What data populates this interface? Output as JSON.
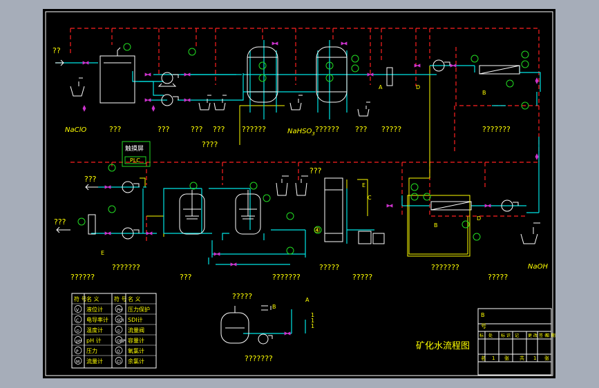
{
  "page": {
    "background": "#a6adb9",
    "sheet_background": "#000000"
  },
  "colors": {
    "process": "#00e5e5",
    "signal": "#ff2020",
    "equipment": "#ffffff",
    "text": "#ffff00",
    "utility": "#ffff00",
    "instrument": "#22dd22",
    "valve": "#cc33cc"
  },
  "top_labels": {
    "inlet": "??",
    "naclo": "NaClO",
    "l1": "???",
    "l2": "???",
    "l3": "???",
    "l4": "???",
    "l5": "??????",
    "nahso3": "NaHSO",
    "nahso3_sub": "3",
    "l6": "??????",
    "l7": "???",
    "l8": "?????",
    "l9": "???????",
    "feed": "????"
  },
  "control_box": {
    "title": "触摸屏",
    "sub": "PLC"
  },
  "bottom_labels": {
    "out1": "???",
    "out2": "???",
    "l1": "???????",
    "l2": "??????",
    "l3": "???",
    "l4": "???????",
    "l5": "?????",
    "l6": "?????",
    "l7": "???????",
    "l8": "?????",
    "naoh": "NaOH",
    "top_col": "???",
    "letter_e": "E",
    "letter_c": "C",
    "letter_d": "D",
    "letter_b": "B",
    "letter_a": "A",
    "letter_d2": "D",
    "letter_b2": "B",
    "letter_e2": "E",
    "circle4": "④"
  },
  "legend": {
    "headers": [
      "符 号",
      "名 义",
      "符 号",
      "名 义"
    ],
    "rows": [
      {
        "s1": "V",
        "n1": "液位计",
        "s2": "PH",
        "n2": "压力保护"
      },
      {
        "s1": "C",
        "n1": "电导率计",
        "s2": "SDI",
        "n2": "SDI计"
      },
      {
        "s1": "⊙",
        "n1": "温度计",
        "s2": "⊙",
        "n2": "流量阀"
      },
      {
        "s1": "pH",
        "n1": "pH 计",
        "s2": "ORP",
        "n2": "容量计"
      },
      {
        "s1": "P",
        "n1": "压力",
        "s2": "O",
        "n2": "氧氯计"
      },
      {
        "s1": "M",
        "n1": "流量计",
        "s2": "Cl",
        "n2": "余氯计"
      }
    ]
  },
  "small_unit": {
    "label_top": "?????",
    "label_b": "B",
    "label_a": "A",
    "label_n1": "1",
    "label_n2": "1",
    "label_n3": "1",
    "caption": "???????"
  },
  "title_text": "矿化水流程图",
  "title_block": {
    "r1": "B",
    "r2": "号",
    "cols": [
      "标",
      "处",
      "标 识",
      "记",
      "更 改",
      "签 名",
      "日 期"
    ],
    "bottom": [
      "名",
      "1",
      "张",
      "共",
      "1",
      "张"
    ]
  }
}
